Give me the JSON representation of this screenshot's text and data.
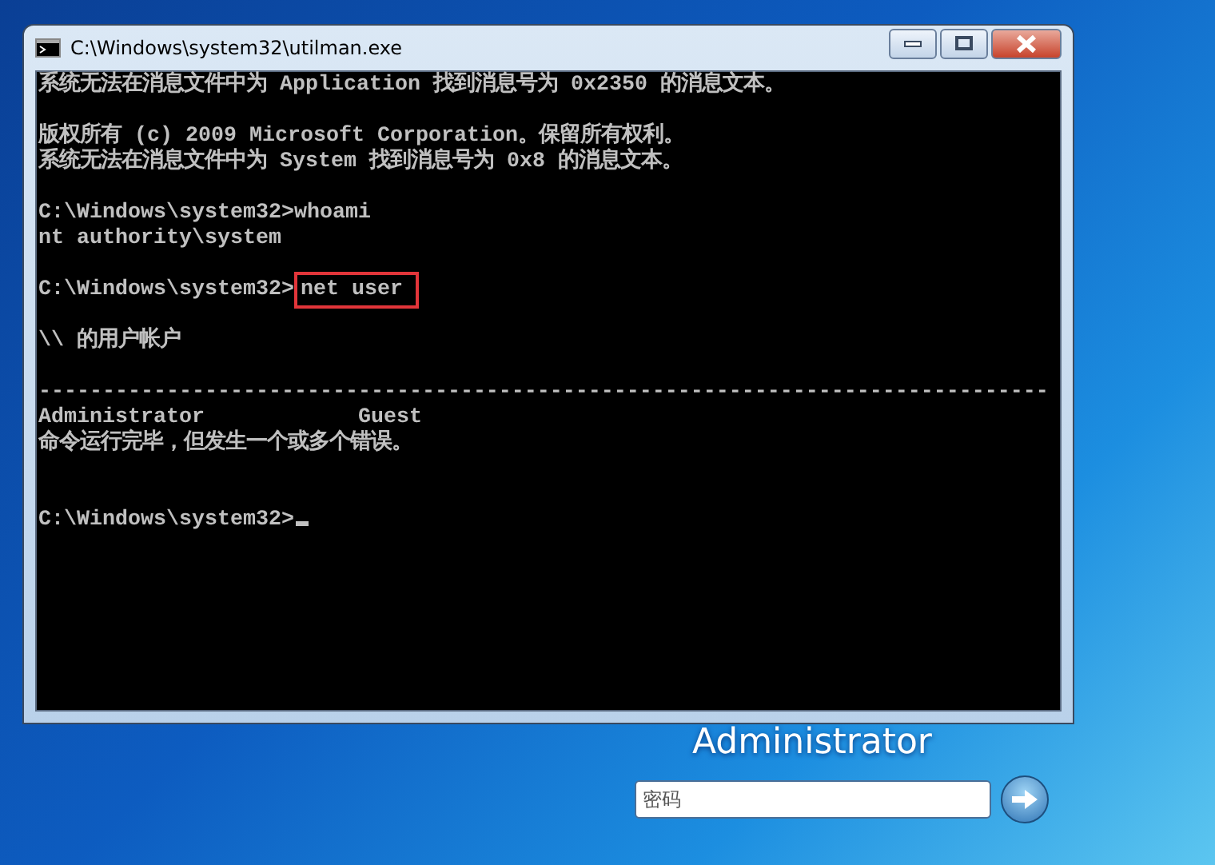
{
  "window": {
    "title": "C:\\Windows\\system32\\utilman.exe",
    "controls": [
      {
        "kind": "minimize"
      },
      {
        "kind": "maximize"
      },
      {
        "kind": "close"
      }
    ]
  },
  "console": {
    "lines": [
      {
        "kind": "text",
        "text": "系统无法在消息文件中为 Application 找到消息号为 0x2350 的消息文本。"
      },
      {
        "kind": "blank"
      },
      {
        "kind": "text",
        "text": "版权所有 (c) 2009 Microsoft Corporation。保留所有权利。"
      },
      {
        "kind": "text",
        "text": "系统无法在消息文件中为 System 找到消息号为 0x8 的消息文本。"
      },
      {
        "kind": "blank"
      },
      {
        "kind": "prompt",
        "prompt": "C:\\Windows\\system32>",
        "command": "whoami"
      },
      {
        "kind": "text",
        "text": "nt authority\\system"
      },
      {
        "kind": "blank"
      },
      {
        "kind": "prompt",
        "prompt": "C:\\Windows\\system32>",
        "command": "net user",
        "highlighted": true
      },
      {
        "kind": "blank"
      },
      {
        "kind": "text",
        "text": "\\\\ 的用户帐户"
      },
      {
        "kind": "blank"
      },
      {
        "kind": "text",
        "text": "-------------------------------------------------------------------------------"
      },
      {
        "kind": "columns",
        "cells": [
          "Administrator",
          "Guest"
        ]
      },
      {
        "kind": "text",
        "text": "命令运行完毕，但发生一个或多个错误。"
      },
      {
        "kind": "blank"
      },
      {
        "kind": "blank"
      },
      {
        "kind": "prompt",
        "prompt": "C:\\Windows\\system32>",
        "cursor": true
      }
    ]
  },
  "login": {
    "username": "Administrator",
    "password": {
      "placeholder": "密码"
    }
  }
}
